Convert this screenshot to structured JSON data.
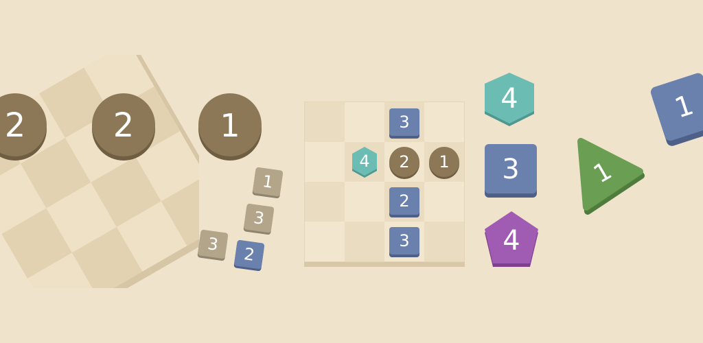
{
  "left_board": {
    "coins": [
      {
        "label": "2",
        "color": "#8c7856"
      },
      {
        "label": "2",
        "color": "#8c7856"
      }
    ]
  },
  "free_coin": {
    "label": "1",
    "color": "#8c7856"
  },
  "small_tiles": [
    {
      "label": "1",
      "color": "#b3a58a"
    },
    {
      "label": "3",
      "color": "#b3a58a"
    },
    {
      "label": "3",
      "color": "#b3a58a"
    },
    {
      "label": "2",
      "color": "#6a80ad"
    }
  ],
  "main_board": {
    "rows": 4,
    "cols": 4,
    "pieces": [
      {
        "label": "3",
        "shape": "square",
        "color": "#6a80ad"
      },
      {
        "label": "4",
        "shape": "hexagon",
        "color": "#6bbcb3"
      },
      {
        "label": "2",
        "shape": "circle",
        "color": "#8c7856"
      },
      {
        "label": "1",
        "shape": "circle",
        "color": "#8c7856"
      },
      {
        "label": "2",
        "shape": "square",
        "color": "#6a80ad"
      },
      {
        "label": "3",
        "shape": "square",
        "color": "#6a80ad"
      }
    ]
  },
  "right_shapes": [
    {
      "label": "4",
      "shape": "hexagon",
      "color": "#6bbcb3"
    },
    {
      "label": "3",
      "shape": "square",
      "color": "#6a80ad"
    },
    {
      "label": "4",
      "shape": "pentagon",
      "color": "#a05cb3"
    },
    {
      "label": "1",
      "shape": "triangle",
      "color": "#6a9e52"
    },
    {
      "label": "1",
      "shape": "square",
      "color": "#6a80ad"
    }
  ]
}
